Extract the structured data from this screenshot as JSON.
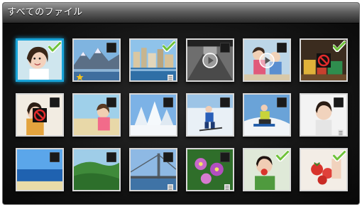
{
  "header": {
    "title": "すべてのファイル"
  },
  "colors": {
    "selection": "#18a3d8",
    "check": "#6fc23a"
  },
  "grid": {
    "tiles": [
      {
        "scene": "portrait-girl",
        "checked": true,
        "selected": true,
        "badge": ""
      },
      {
        "scene": "lake-mountains",
        "checked": false,
        "selected": false,
        "badge": "star"
      },
      {
        "scene": "harbor-city",
        "checked": true,
        "selected": false,
        "badge": "protect"
      },
      {
        "scene": "video-tunnel",
        "checked": false,
        "selected": false,
        "badge": "play"
      },
      {
        "scene": "video-kids",
        "checked": false,
        "selected": false,
        "badge": "play"
      },
      {
        "scene": "toys-blocked",
        "checked": true,
        "selected": false,
        "badge": "noentry"
      },
      {
        "scene": "child-blocked",
        "checked": false,
        "selected": false,
        "badge": "noentry"
      },
      {
        "scene": "beach-girl",
        "checked": false,
        "selected": false,
        "badge": ""
      },
      {
        "scene": "snow-trees",
        "checked": false,
        "selected": false,
        "badge": ""
      },
      {
        "scene": "skier",
        "checked": false,
        "selected": false,
        "badge": ""
      },
      {
        "scene": "snowboarder",
        "checked": false,
        "selected": false,
        "badge": ""
      },
      {
        "scene": "smiling-kid",
        "checked": false,
        "selected": false,
        "badge": "protect"
      },
      {
        "scene": "sea-sky",
        "checked": false,
        "selected": false,
        "badge": ""
      },
      {
        "scene": "green-hills",
        "checked": false,
        "selected": false,
        "badge": ""
      },
      {
        "scene": "bridge",
        "checked": false,
        "selected": false,
        "badge": "protect"
      },
      {
        "scene": "flowers",
        "checked": false,
        "selected": false,
        "badge": "protect"
      },
      {
        "scene": "boy-eating",
        "checked": true,
        "selected": false,
        "badge": ""
      },
      {
        "scene": "strawberries",
        "checked": true,
        "selected": false,
        "badge": ""
      }
    ]
  }
}
